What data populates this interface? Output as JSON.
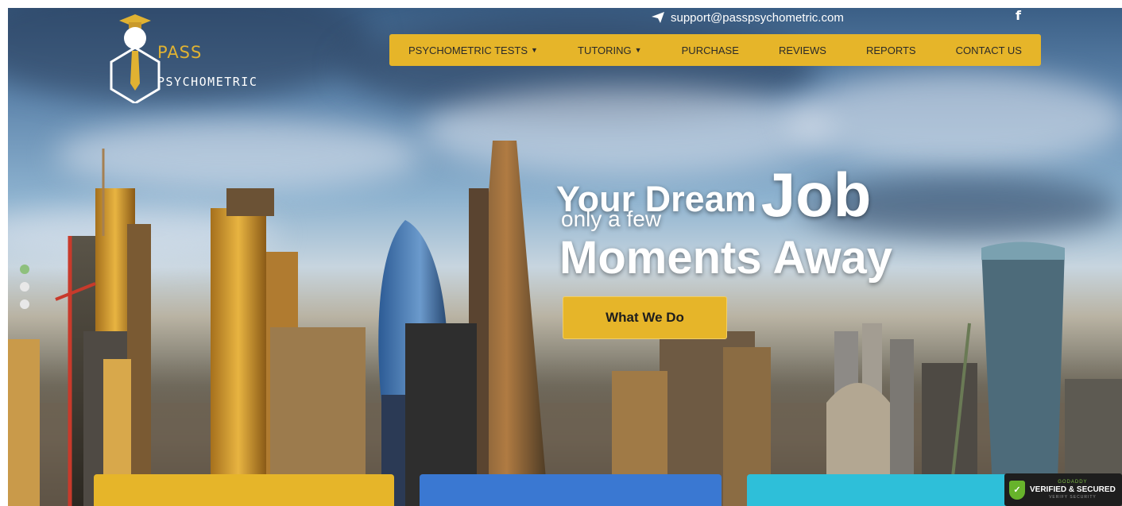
{
  "logo": {
    "line1": "PASS",
    "line2": "PSYCHOMETRIC"
  },
  "topbar": {
    "email": "support@passpsychometric.com",
    "email_icon": "paper-plane-icon",
    "social_icon": "facebook-icon",
    "social_glyph": "f"
  },
  "nav": {
    "items": [
      {
        "label": "PSYCHOMETRIC TESTS",
        "has_dropdown": true
      },
      {
        "label": "TUTORING",
        "has_dropdown": true
      },
      {
        "label": "PURCHASE",
        "has_dropdown": false
      },
      {
        "label": "REVIEWS",
        "has_dropdown": false
      },
      {
        "label": "REPORTS",
        "has_dropdown": false
      },
      {
        "label": "CONTACT US",
        "has_dropdown": false
      }
    ],
    "dropdown_glyph": "▼",
    "background": "#e6b529"
  },
  "hero": {
    "line1_a": "Your Dream",
    "line1_b": "Job",
    "line2": "only a few",
    "line3": "Moments Away",
    "cta_label": "What We Do"
  },
  "slider": {
    "active_index": 0,
    "dot_count": 3,
    "active_color": "#8ec07d"
  },
  "cards": {
    "colors": [
      "#e6b529",
      "#3a78d2",
      "#2ebfd9"
    ]
  },
  "badge": {
    "top": "GODADDY",
    "main": "VERIFIED & SECURED",
    "bottom": "VERIFY SECURITY"
  }
}
